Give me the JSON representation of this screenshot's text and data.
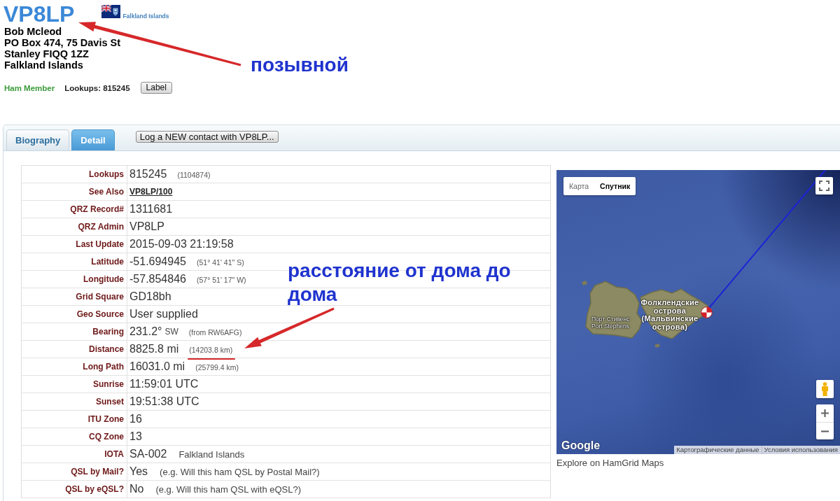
{
  "header": {
    "callsign": "VP8LP",
    "country": "Falkland Islands",
    "address": [
      "Bob Mcleod",
      "PO Box 474, 75 Davis St",
      "Stanley FIQQ 1ZZ",
      "Falkland Islands"
    ],
    "member_status": "Ham Member",
    "lookups": "Lookups: 815245",
    "label_button": "Label"
  },
  "tabs": [
    {
      "label": "Biography",
      "selected": false
    },
    {
      "label": "Detail",
      "selected": true
    }
  ],
  "log_button": "Log a NEW contact with VP8LP...",
  "detail": {
    "rows": [
      {
        "label": "Lookups",
        "kind": "text",
        "value": "815245",
        "note": {
          "kind": "small",
          "text": "(1104874)"
        },
        "underlined": false
      },
      {
        "label": "See Also",
        "kind": "link",
        "value": "VP8LP/100",
        "underlined": false
      },
      {
        "label": "QRZ Record#",
        "kind": "text",
        "value": "1311681",
        "underlined": false
      },
      {
        "label": "QRZ Admin",
        "kind": "text",
        "value": "VP8LP",
        "underlined": false
      },
      {
        "label": "Last Update",
        "kind": "text",
        "value": "2015-09-03 21:19:58",
        "underlined": false
      },
      {
        "label": "Latitude",
        "kind": "text",
        "value": "-51.694945",
        "note": {
          "kind": "small",
          "text": "(51° 41' 41\" S)"
        },
        "underlined": false
      },
      {
        "label": "Longitude",
        "kind": "text",
        "value": "-57.854846",
        "note": {
          "kind": "small",
          "text": "(57° 51' 17\" W)"
        },
        "underlined": false
      },
      {
        "label": "Grid Square",
        "kind": "text",
        "value": "GD18bh",
        "underlined": false
      },
      {
        "label": "Geo Source",
        "kind": "text",
        "value": "User supplied",
        "underlined": false
      },
      {
        "label": "Bearing",
        "kind": "text",
        "value": "231.2°",
        "unit": "SW",
        "note": {
          "kind": "small",
          "text": "(from RW6AFG)"
        },
        "underlined": false
      },
      {
        "label": "Distance",
        "kind": "text",
        "value": "8825.8 mi",
        "note": {
          "kind": "small",
          "text": "(14203.8 km)"
        },
        "underlined": true
      },
      {
        "label": "Long Path",
        "kind": "text",
        "value": "16031.0 mi",
        "note": {
          "kind": "small",
          "text": "(25799.4 km)"
        },
        "underlined": false
      },
      {
        "label": "Sunrise",
        "kind": "text",
        "value": "11:59:01 UTC",
        "underlined": false
      },
      {
        "label": "Sunset",
        "kind": "text",
        "value": "19:51:38 UTC",
        "underlined": false
      },
      {
        "label": "ITU Zone",
        "kind": "text",
        "value": "16",
        "underlined": false
      },
      {
        "label": "CQ Zone",
        "kind": "text",
        "value": "13",
        "underlined": false
      },
      {
        "label": "IOTA",
        "kind": "text",
        "value": "SA-002",
        "note": {
          "kind": "plain",
          "text": "Falkland Islands"
        },
        "underlined": false
      },
      {
        "label": "QSL by Mail?",
        "kind": "text",
        "value": "Yes",
        "note": {
          "kind": "plain",
          "text": "(e.g. Will this ham QSL by Postal Mail?)"
        },
        "underlined": false
      },
      {
        "label": "QSL by eQSL?",
        "kind": "text",
        "value": "No",
        "note": {
          "kind": "plain",
          "text": "(e.g. Will this ham QSL with eQSL?)"
        },
        "underlined": false
      }
    ]
  },
  "map": {
    "types": [
      {
        "label": "Карта",
        "selected": false
      },
      {
        "label": "Спутник",
        "selected": true
      }
    ],
    "region_label": "Фолклендские острова (Мальвинские острова)",
    "place_label": [
      "Порт Стивенс",
      "Port Stephens"
    ],
    "logo": "Google",
    "attribution": [
      "Картографические данные",
      "Условия использования"
    ],
    "link": "Explore on HamGrid Maps"
  },
  "annotations": [
    {
      "text": "позывной"
    },
    {
      "text": "расстояние от дома до дома"
    }
  ]
}
